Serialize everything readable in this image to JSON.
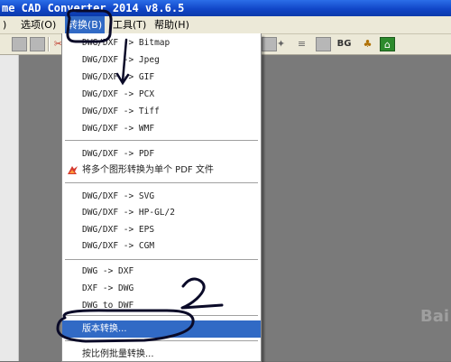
{
  "window": {
    "title": "me CAD Converter 2014 v8.6.5"
  },
  "menubar": {
    "items": [
      {
        "label": ") "
      },
      {
        "label": "选项(O)"
      },
      {
        "label": "转换(B)"
      },
      {
        "label": "工具(T)"
      },
      {
        "label": "帮助(H)"
      }
    ]
  },
  "toolbar": {
    "bg_label": "BG",
    "icons": [
      "save-icon",
      "export-icon",
      "cut-icon",
      "print-icon",
      "layer-icon",
      "pdf-icon",
      "text-icon",
      "gear-icon",
      "puzzle-icon",
      "layers-icon",
      "grid-icon",
      "person-icon",
      "home-icon"
    ]
  },
  "menu": {
    "items": [
      {
        "label": "DWG/DXF -> Bitmap"
      },
      {
        "label": "DWG/DXF -> Jpeg"
      },
      {
        "label": "DWG/DXF -> GIF"
      },
      {
        "label": "DWG/DXF -> PCX"
      },
      {
        "label": "DWG/DXF -> Tiff"
      },
      {
        "label": "DWG/DXF -> WMF"
      },
      {
        "label": "DWG/DXF -> PDF"
      },
      {
        "label": "将多个图形转换为单个 PDF 文件",
        "icon": "pdf-icon"
      },
      {
        "label": "DWG/DXF -> SVG"
      },
      {
        "label": "DWG/DXF -> HP-GL/2"
      },
      {
        "label": "DWG/DXF -> EPS"
      },
      {
        "label": "DWG/DXF -> CGM"
      },
      {
        "label": "DWG -> DXF"
      },
      {
        "label": "DXF -> DWG"
      },
      {
        "label": "DWG to DWF"
      },
      {
        "label": "版本转换..."
      },
      {
        "label": "按比例批量转换..."
      }
    ]
  },
  "annotation": {
    "number": "2"
  },
  "watermark": "Bai",
  "colors": {
    "title_bar": "#1146c8",
    "highlight": "#316ac5",
    "menu_bg": "#ece9d8",
    "annotation_ink": "#0a0a28"
  }
}
